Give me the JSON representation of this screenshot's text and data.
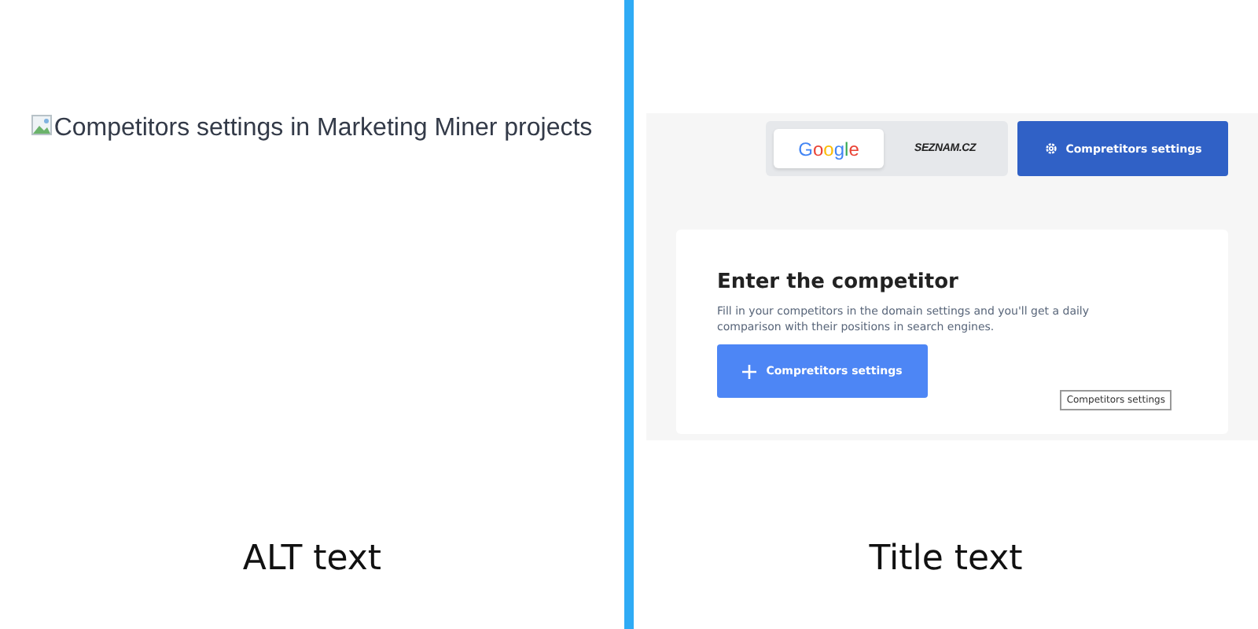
{
  "alt_side": {
    "image_alt": "Competitors settings in Marketing Miner projects",
    "caption": "ALT text"
  },
  "title_side": {
    "engine_tabs": [
      {
        "label": "Google",
        "kind": "google",
        "selected": true
      },
      {
        "label": "SEZNAM.CZ",
        "kind": "seznam",
        "selected": false
      }
    ],
    "settings_button": "Compretitors settings",
    "card": {
      "title": "Enter the competitor",
      "description": "Fill in your competitors in the domain settings and you'll get a daily comparison with their positions in search engines.",
      "button": "Compretitors settings"
    },
    "tooltip": "Competitors settings",
    "caption": "Title text"
  }
}
